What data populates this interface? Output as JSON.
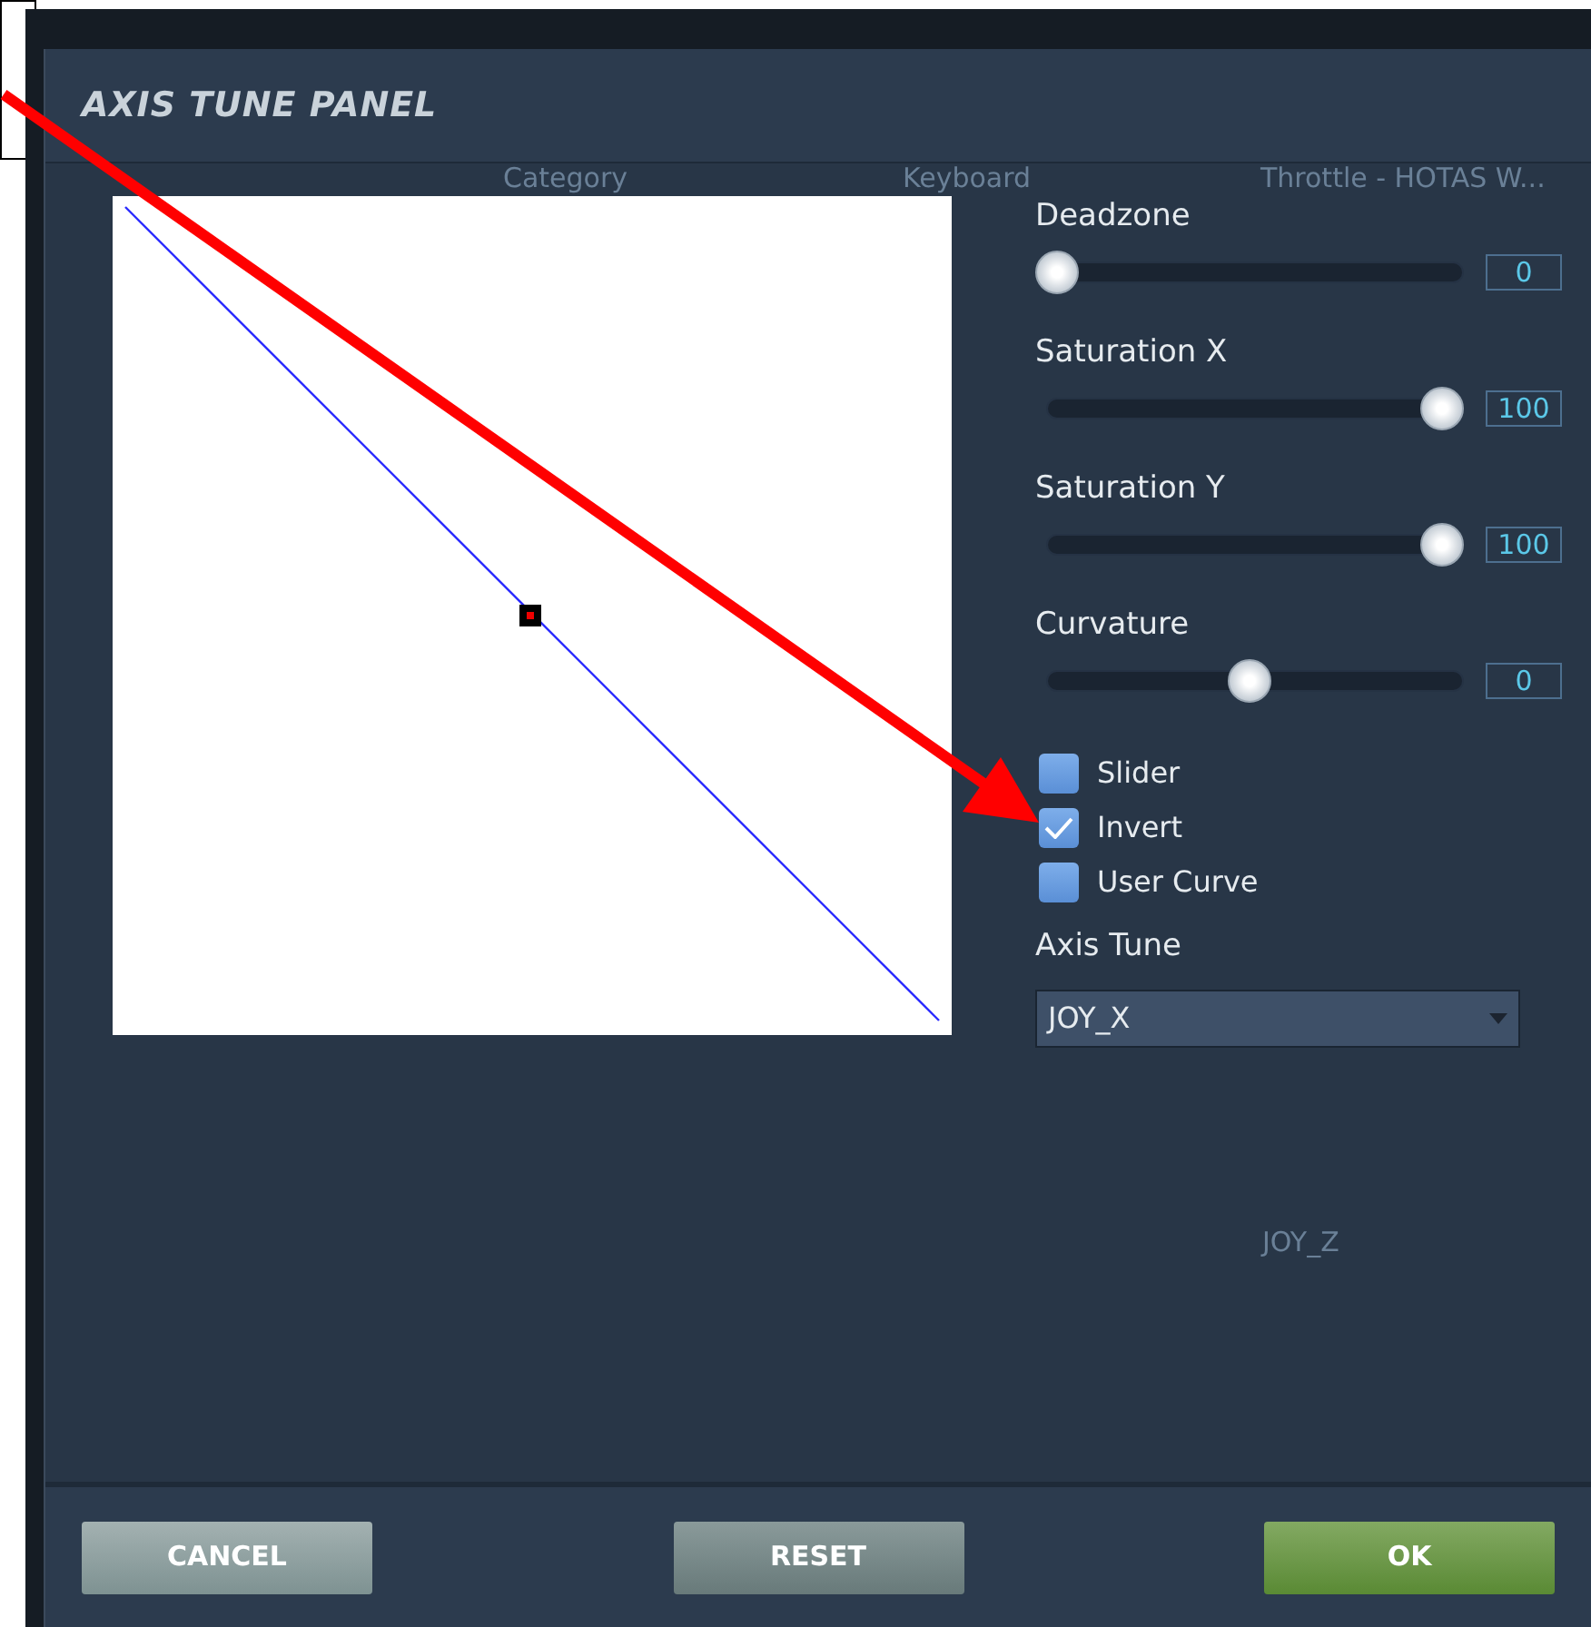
{
  "panel": {
    "title": "AXIS TUNE PANEL"
  },
  "background": {
    "columns": [
      "Category",
      "Keyboard",
      "Throttle - HOTAS W..."
    ],
    "cell": "JOY_Z"
  },
  "sliders": [
    {
      "label": "Deadzone",
      "level": 0,
      "value": "0"
    },
    {
      "label": "Saturation X",
      "level": 1,
      "value": "100"
    },
    {
      "label": "Saturation Y",
      "level": 1,
      "value": "100"
    },
    {
      "label": "Curvature",
      "level": 0.5,
      "value": "0"
    }
  ],
  "checkboxes": [
    {
      "label": "Slider",
      "checked": false
    },
    {
      "label": "Invert",
      "checked": true
    },
    {
      "label": "User Curve",
      "checked": false
    }
  ],
  "axis_tune": {
    "label": "Axis Tune",
    "value": "JOY_X"
  },
  "buttons": [
    {
      "label": "CANCEL",
      "kind": "light"
    },
    {
      "label": "RESET",
      "kind": "dark"
    },
    {
      "label": "OK",
      "kind": "primary"
    }
  ]
}
